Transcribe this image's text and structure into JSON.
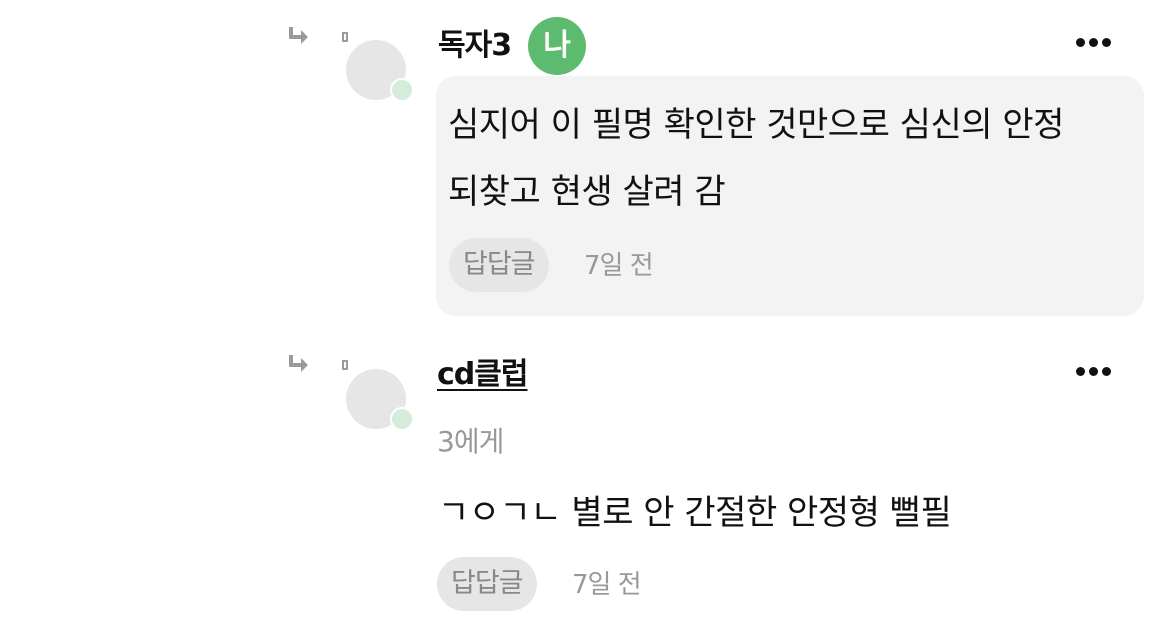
{
  "comments": [
    {
      "author": "독자3",
      "me_badge": "나",
      "text_lines": [
        "심지어 이 필명 확인한 것만으로 심신의 안정",
        "되찾고 현생 살려 감"
      ],
      "reply_label": "답답글",
      "time": "7일 전",
      "more_icon": "more-horizontal-icon",
      "reply_icon": "reply-arrow-icon"
    },
    {
      "author": "cd클럽",
      "mention": "3에게",
      "text": "ㄱㅇㄱㄴ 별로 안 간절한 안정형 뻘필",
      "reply_label": "답답글",
      "time": "7일 전",
      "more_icon": "more-horizontal-icon",
      "reply_icon": "reply-arrow-icon"
    }
  ],
  "colors": {
    "me_badge": "#5cbb6e",
    "bubble_bg": "#f3f3f3",
    "avatar_dot": "#d4ecd9",
    "meta_text": "#999999"
  }
}
